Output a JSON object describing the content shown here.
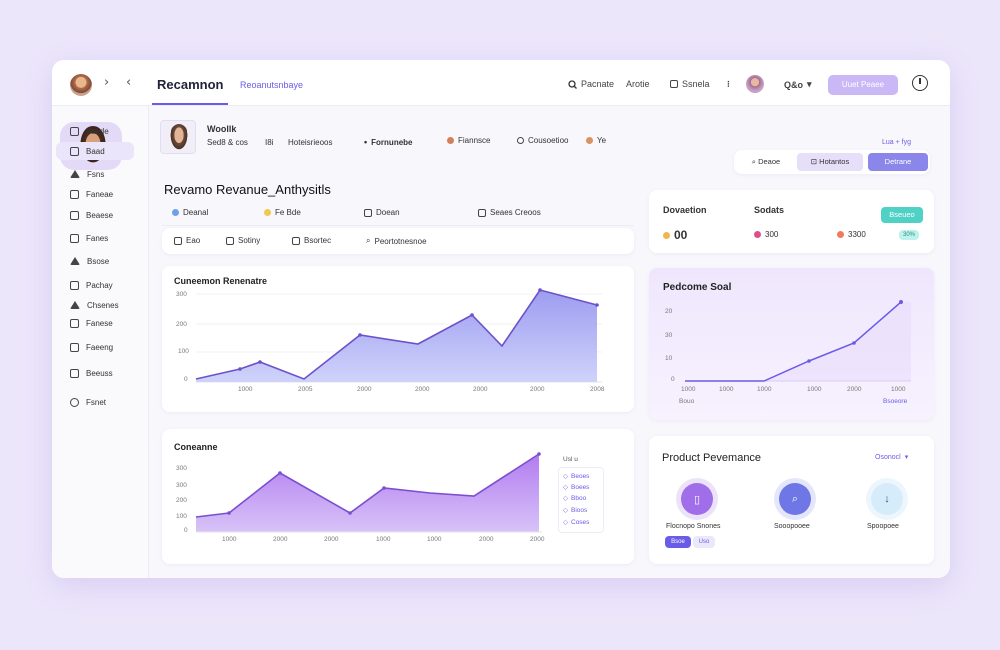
{
  "topbar": {
    "title": "Recamnon",
    "breadcrumb": "Reoanutsnbaye",
    "items": [
      "Pacnate",
      "Arotie",
      "Ssnela"
    ],
    "user_menu": "Q&o",
    "action_button": "Uuet Peaee"
  },
  "sidebar": {
    "items": [
      {
        "label": "Bacde"
      },
      {
        "label": "Baad"
      },
      {
        "label": "Fsns"
      },
      {
        "label": "Faneae"
      },
      {
        "label": "Beaese"
      },
      {
        "label": "Fanes"
      },
      {
        "label": "Bsose"
      },
      {
        "label": "Pachay"
      },
      {
        "label": "Chsenes"
      },
      {
        "label": "Fanese"
      },
      {
        "label": "Faeeng"
      },
      {
        "label": "Beeuss"
      },
      {
        "label": "Fsnet"
      }
    ]
  },
  "profile_header": {
    "name": "Woollk",
    "subtitle": "Sed8 & cos",
    "count": "I8i",
    "meta": "Hoteisrieoos",
    "people": [
      "Fornunebe",
      "Fiannsce",
      "Cousoetioo",
      "Ye"
    ]
  },
  "page_title": "Revamo Revanue_Anthysitls",
  "filters": [
    "Deanal",
    "Fe Bde",
    "Doean",
    "Seaes Creoos"
  ],
  "tabs": [
    "Eao",
    "Sotiny",
    "Bsortec",
    "Peortotnesnoe"
  ],
  "right_actions": {
    "hint": "Lua + fyg",
    "buttons": [
      "Deaoe",
      "Hotantos",
      "Detrane"
    ]
  },
  "summary": {
    "col1_label": "Dovaetion",
    "col1_value": "00",
    "col2_label": "Sodats",
    "col2_value": "300",
    "col3_value": "3300",
    "button": "Bseueo",
    "badge": "30%"
  },
  "chart_main": {
    "title": "Cuneemon Renenatre",
    "y_ticks": [
      "300",
      "200",
      "100",
      "0"
    ],
    "x_ticks": [
      "1000",
      "2005",
      "2000",
      "2000",
      "2000",
      "2000",
      "2008"
    ]
  },
  "chart_perf": {
    "title": "Pedcome Soal",
    "y_ticks": [
      "20",
      "30",
      "10",
      "0"
    ],
    "x_ticks": [
      "1000",
      "1000",
      "1000",
      "1000",
      "2000",
      "1000"
    ],
    "x_sub_left": "Bouo",
    "x_sub_right": "Bsoeore"
  },
  "chart_bottom": {
    "title": "Coneanne",
    "y_ticks": [
      "300",
      "300",
      "200",
      "100",
      "0"
    ],
    "x_ticks": [
      "1000",
      "2000",
      "2000",
      "1000",
      "1000",
      "2000",
      "2000"
    ],
    "legend_title": "Usl u",
    "legend": [
      "Beoes",
      "Boees",
      "Bboo",
      "Bioos",
      "Coses"
    ]
  },
  "product": {
    "title": "Product Pevemance",
    "dropdown": "Osonocl",
    "items": [
      "Flocnopo Snones",
      "Sooopooee",
      "Spoopoee"
    ],
    "chips": [
      "Bsoe",
      "Uso"
    ]
  },
  "colors": {
    "accent": "#6b5ce7",
    "area": "#b9b4f3",
    "area_purple": "#c7a2f4"
  },
  "icons": [
    "chevron-right-icon",
    "chevron-left-icon",
    "search-icon",
    "timer-icon"
  ]
}
